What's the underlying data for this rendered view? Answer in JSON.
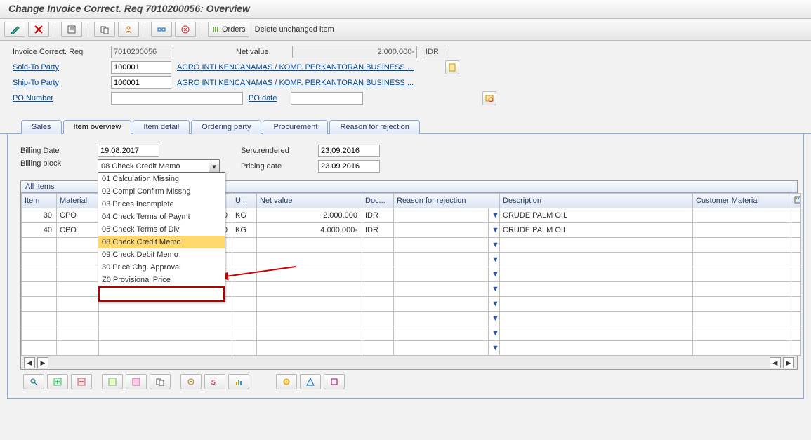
{
  "title": "Change Invoice Correct. Req 7010200056: Overview",
  "toolbar": {
    "orders_label": "Orders",
    "delete_unchanged_label": "Delete unchanged item"
  },
  "header": {
    "req_label": "Invoice Correct. Req",
    "req_value": "7010200056",
    "netvalue_label": "Net value",
    "netvalue_value": "2.000.000-",
    "netvalue_curr": "IDR",
    "soldto_label": "Sold-To Party",
    "soldto_value": "100001",
    "soldto_text": "AGRO INTI KENCANAMAS / KOMP. PERKANTORAN BUSINESS ...",
    "shipto_label": "Ship-To Party",
    "shipto_value": "100001",
    "shipto_text": "AGRO INTI KENCANAMAS / KOMP. PERKANTORAN BUSINESS ...",
    "po_label": "PO Number",
    "po_value": "",
    "podate_label": "PO date",
    "podate_value": ""
  },
  "tabs": {
    "sales": "Sales",
    "item_overview": "Item overview",
    "item_detail": "Item detail",
    "ordering_party": "Ordering party",
    "procurement": "Procurement",
    "reason_rejection": "Reason for rejection"
  },
  "billing": {
    "billing_date_label": "Billing Date",
    "billing_date_value": "19.08.2017",
    "billing_block_label": "Billing block",
    "billing_block_value": "08 Check Credit Memo",
    "serv_rendered_label": "Serv.rendered",
    "serv_rendered_value": "23.09.2016",
    "pricing_date_label": "Pricing date",
    "pricing_date_value": "23.09.2016",
    "block_options": [
      "01 Calculation Missing",
      "02 Compl Confirm Missng",
      "03 Prices Incomplete",
      "04 Check Terms of Paymt",
      "05 Check Terms of Dlv",
      "08 Check Credit Memo",
      "09 Check Debit Memo",
      "30 Price Chg. Approval",
      "Z0 Provisional Price"
    ]
  },
  "grid": {
    "section_title": "All items",
    "headers": {
      "item": "Item",
      "material": "Material",
      "qty": "",
      "uom": "U...",
      "netvalue": "Net value",
      "doccur": "Doc...",
      "reason": "Reason for rejection",
      "desc": "Description",
      "custmat": "Customer Material"
    },
    "rows": [
      {
        "item": "30",
        "material": "CPO",
        "qty": "200",
        "uom": "KG",
        "netvalue": "2.000.000",
        "doccur": "IDR",
        "desc": "CRUDE PALM OIL"
      },
      {
        "item": "40",
        "material": "CPO",
        "qty": "200",
        "uom": "KG",
        "netvalue": "4.000.000-",
        "doccur": "IDR",
        "desc": "CRUDE PALM OIL"
      }
    ],
    "empty_rows": 8
  }
}
